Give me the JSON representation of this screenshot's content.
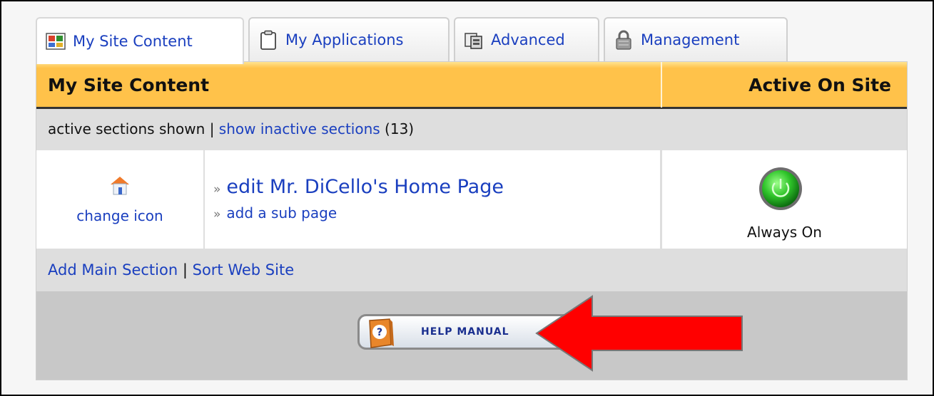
{
  "tabs": [
    {
      "label": "My Site Content",
      "icon": "site-content-icon",
      "active": true
    },
    {
      "label": "My Applications",
      "icon": "clipboard-icon",
      "active": false
    },
    {
      "label": "Advanced",
      "icon": "advanced-icon",
      "active": false
    },
    {
      "label": "Management",
      "icon": "lock-icon",
      "active": false
    }
  ],
  "header": {
    "title": "My Site Content",
    "active_col": "Active On Site"
  },
  "filter": {
    "shown_text": "active sections shown",
    "separator": "|",
    "inactive_link": "show inactive sections",
    "inactive_count": "(13)"
  },
  "section": {
    "change_icon": "change icon",
    "edit_link": "edit Mr. DiCello's Home Page",
    "sub_link": "add a sub page",
    "status": "Always On",
    "raquo": "»"
  },
  "footer": {
    "add_main": "Add Main Section",
    "separator": "|",
    "sort": "Sort Web Site"
  },
  "help": {
    "label": "HELP MANUAL"
  },
  "colors": {
    "header": "#ffc24a",
    "link": "#1a3fbf",
    "arrow": "#ff0000"
  }
}
